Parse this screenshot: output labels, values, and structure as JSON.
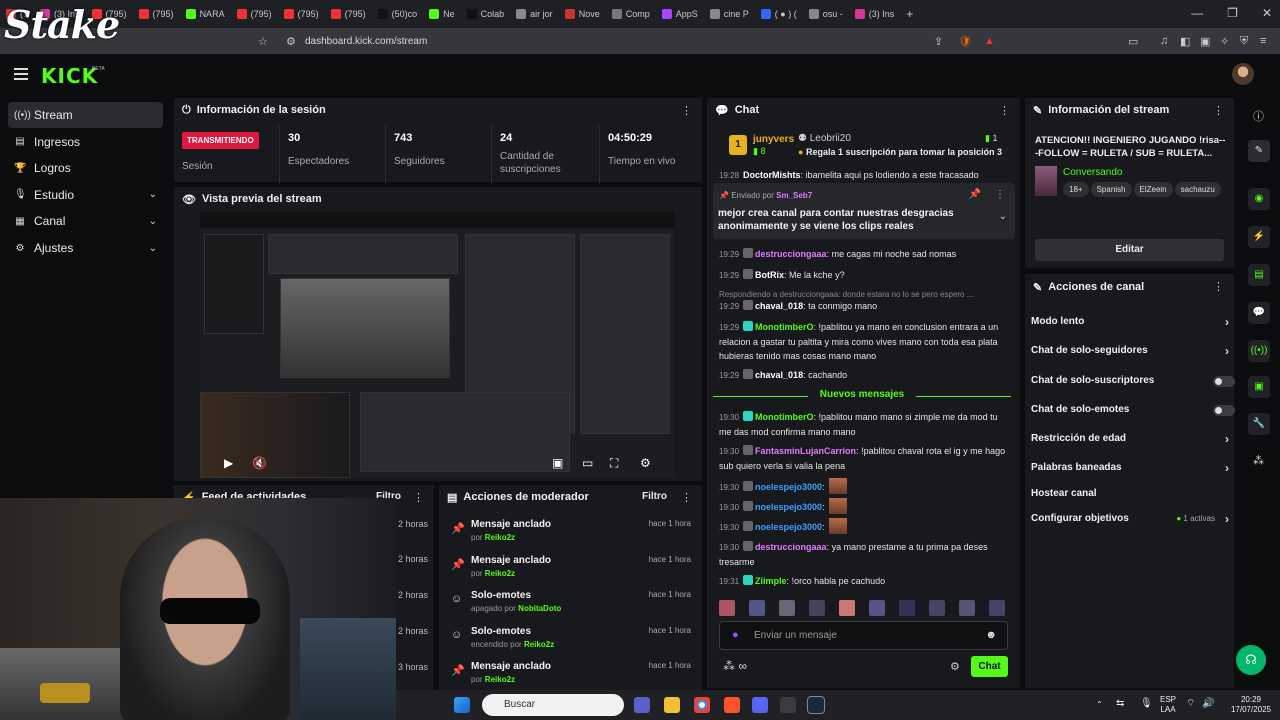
{
  "browser": {
    "tabs": [
      {
        "label": "(7",
        "color": "#e33"
      },
      {
        "label": "(3) Ins",
        "color": "#d2399b"
      },
      {
        "label": "(795)",
        "color": "#e33"
      },
      {
        "label": "(795)",
        "color": "#e33"
      },
      {
        "label": "NARA",
        "color": "#53fc18"
      },
      {
        "label": "(795)",
        "color": "#e33"
      },
      {
        "label": "(795)",
        "color": "#e33"
      },
      {
        "label": "(795)",
        "color": "#e33"
      },
      {
        "label": "(50)co",
        "color": "#111"
      },
      {
        "label": "Ne",
        "color": "#53fc18"
      },
      {
        "label": "Colab",
        "color": "#111"
      },
      {
        "label": "air jor",
        "color": "#888"
      },
      {
        "label": "Nove",
        "color": "#c33"
      },
      {
        "label": "Comp",
        "color": "#777"
      },
      {
        "label": "AppS",
        "color": "#a4f"
      },
      {
        "label": "cine P",
        "color": "#888"
      },
      {
        "label": "( ● ) (",
        "color": "#36f"
      },
      {
        "label": "osu -",
        "color": "#888"
      },
      {
        "label": "(3) Ins",
        "color": "#d2399b"
      }
    ],
    "url": "dashboard.kick.com/stream",
    "new_tab": "+",
    "win_min": "—",
    "win_max": "❐",
    "win_close": "✕"
  },
  "overlay": {
    "stake_logo": "Stake"
  },
  "header": {
    "logo": "KICK",
    "beta": "BETA"
  },
  "sidebar": {
    "items": [
      {
        "label": "Stream",
        "icon": "stream-icon",
        "glyph": "((•))",
        "expandable": false
      },
      {
        "label": "Ingresos",
        "icon": "revenue-icon",
        "glyph": "▤",
        "expandable": false
      },
      {
        "label": "Logros",
        "icon": "trophy-icon",
        "glyph": "🏆",
        "expandable": false
      },
      {
        "label": "Estudio",
        "icon": "studio-icon",
        "glyph": "🎙",
        "expandable": true
      },
      {
        "label": "Canal",
        "icon": "channel-icon",
        "glyph": "▦",
        "expandable": true
      },
      {
        "label": "Ajustes",
        "icon": "settings-icon",
        "glyph": "⚙",
        "expandable": true
      }
    ]
  },
  "session": {
    "title": "Información de la sesión",
    "live_badge": "TRANSMITIENDO",
    "session_label": "Sesión",
    "stats": [
      {
        "value": "30",
        "label": "Espectadores"
      },
      {
        "value": "743",
        "label": "Seguidores"
      },
      {
        "value": "24",
        "label": "Cantidad de suscripciones"
      },
      {
        "value": "04:50:29",
        "label": "Tiempo en vivo"
      }
    ]
  },
  "preview": {
    "title": "Vista previa del stream"
  },
  "feed": {
    "title": "Feed de actividades",
    "filter": "Filtro",
    "times": [
      "2 horas",
      "2 horas",
      "2 horas",
      "2 horas",
      "3 horas"
    ]
  },
  "mod_actions": {
    "title": "Acciones de moderador",
    "filter": "Filtro",
    "rows": [
      {
        "title": "Mensaje anclado",
        "by": "por",
        "user": "Reiko2z",
        "time": "hace 1 hora",
        "glyph": "📌"
      },
      {
        "title": "Mensaje anclado",
        "by": "por",
        "user": "Reiko2z",
        "time": "hace 1 hora",
        "glyph": "📌"
      },
      {
        "title": "Solo-emotes",
        "by": "apagado por",
        "user": "NobitaDoto",
        "time": "hace 1 hora",
        "glyph": "☺"
      },
      {
        "title": "Solo-emotes",
        "by": "encendido por",
        "user": "Reiko2z",
        "time": "hace 1 hora",
        "glyph": "☺"
      },
      {
        "title": "Mensaje anclado",
        "by": "por",
        "user": "Reiko2z",
        "time": "hace 1 hora",
        "glyph": "📌"
      }
    ]
  },
  "chat": {
    "title": "Chat",
    "gift": {
      "user": "junyvers",
      "count": "8",
      "rank": "1",
      "sender": "Leobrii20",
      "count2": "1",
      "text": "Regala 1 suscripción para tomar la posición 3"
    },
    "partial": {
      "time": "19:28",
      "user": "DoctorMishts",
      "text": "ibamelita aqui ps lodiendo a este fracasado"
    },
    "pinned": {
      "label": "Enviado por",
      "user": "Sm_Seb7",
      "text": "mejor crea canal para contar nuestras desgracias anonimamente y se viene los clips reales"
    },
    "messages": [
      {
        "time": "19:29",
        "user": "destrucciongaaa",
        "color": "#e07bff",
        "text": "me cagas mi noche sad nomas"
      },
      {
        "time": "19:29",
        "user": "BotRix",
        "color": "#ffffff",
        "text": "Me la kche y?"
      },
      {
        "time": "",
        "user": "",
        "color": "#888",
        "text": "Respondiendo a destrucciongaaa: donde estara no lo se pero espero ..."
      },
      {
        "time": "19:29",
        "user": "chaval_018",
        "color": "#ffffff",
        "text": "ta conmigo mano"
      },
      {
        "time": "19:29",
        "user": "MonotimberO",
        "color": "#53fc18",
        "text": "!pablitou ya mano en conclusion entrara a un relacion a gastar tu paltita y mira como vives mano con toda esa plata hubieras tenido mas cosas mano mano"
      },
      {
        "time": "19:29",
        "user": "chaval_018",
        "color": "#ffffff",
        "text": "cachando"
      }
    ],
    "new_messages": "Nuevos mensajes",
    "messages2": [
      {
        "time": "19:30",
        "user": "MonotimberO",
        "color": "#53fc18",
        "text": "!pablitou mano mano si zimple me da mod tu me das mod confirma mano mano"
      },
      {
        "time": "19:30",
        "user": "FantasminLujanCarrion",
        "color": "#e07bff",
        "text": "!pablitou chaval rota el ig y me hago sub quiero verla si valia la pena"
      },
      {
        "time": "19:30",
        "user": "noelespejo3000",
        "color": "#3aa0ff",
        "text": ""
      },
      {
        "time": "19:30",
        "user": "noelespejo3000",
        "color": "#3aa0ff",
        "text": ""
      },
      {
        "time": "19:30",
        "user": "noelespejo3000",
        "color": "#3aa0ff",
        "text": ""
      },
      {
        "time": "19:30",
        "user": "destrucciongaaa",
        "color": "#e07bff",
        "text": "ya mano prestame a tu prima pa deses tresarme"
      },
      {
        "time": "19:31",
        "user": "Ziimple",
        "color": "#53fc18",
        "text": "!orco habla pe cachudo"
      }
    ],
    "input_placeholder": "Enviar un mensaje",
    "send_label": "Chat"
  },
  "stream_info": {
    "title": "Información del stream",
    "stream_title": "ATENCION!! INGENIERO JUGANDO !risa---FOLLOW = RULETA / SUB = RULETA...",
    "category": "Conversando",
    "tags": [
      "18+",
      "Spanish",
      "ElZeein",
      "sachauzu"
    ],
    "edit": "Editar"
  },
  "channel_actions": {
    "title": "Acciones de canal",
    "rows": [
      {
        "label": "Modo lento",
        "control": "arrow"
      },
      {
        "label": "Chat de solo-seguidores",
        "control": "arrow"
      },
      {
        "label": "Chat de solo-suscriptores",
        "control": "toggle"
      },
      {
        "label": "Chat de solo-emotes",
        "control": "toggle"
      },
      {
        "label": "Restricción de edad",
        "control": "arrow"
      },
      {
        "label": "Palabras baneadas",
        "control": "arrow"
      },
      {
        "label": "Hostear canal",
        "control": "none"
      },
      {
        "label": "Configurar objetivos",
        "control": "arrow"
      }
    ],
    "goals_active": "1 activas"
  },
  "taskbar": {
    "search": "Buscar",
    "lang": "ESP",
    "lang2": "LAA",
    "time": "20:29",
    "date": "17/07/2025"
  },
  "colors": {
    "accent": "#53fc18",
    "live": "#e0173f",
    "panel": "#18191c",
    "bg": "#0b0c0e"
  }
}
